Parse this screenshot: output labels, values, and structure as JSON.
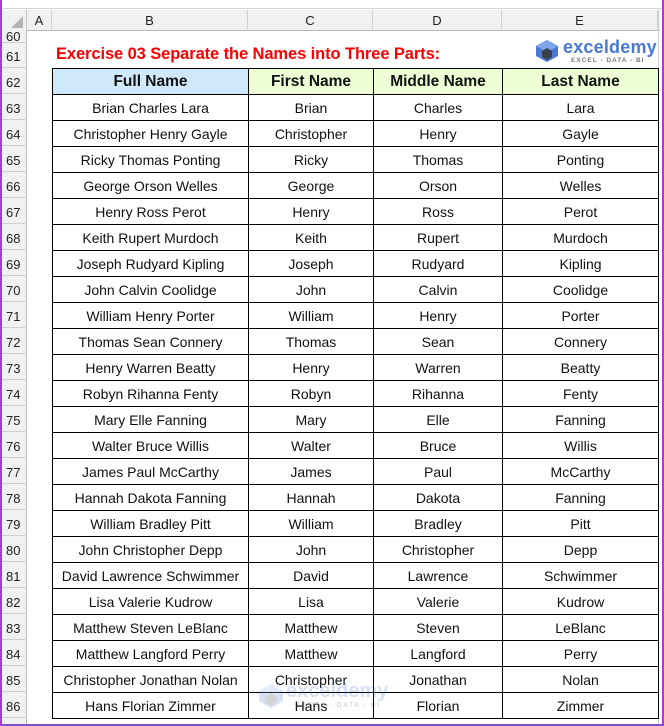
{
  "sheet": {
    "column_headers": [
      "A",
      "B",
      "C",
      "D",
      "E"
    ],
    "row_numbers": [
      "60",
      "61",
      "62",
      "63",
      "64",
      "65",
      "66",
      "67",
      "68",
      "69",
      "70",
      "71",
      "72",
      "73",
      "74",
      "75",
      "76",
      "77",
      "78",
      "79",
      "80",
      "81",
      "82",
      "83",
      "84",
      "85",
      "86"
    ]
  },
  "title": "Exercise 03 Separate the Names into Three Parts:",
  "logo": {
    "name": "exceldemy",
    "tagline": "EXCEL - DATA - BI",
    "icon": "exceldemy-logo-icon"
  },
  "colors": {
    "title": "#ff0000",
    "full_name_header_bg": "#cfe9fb",
    "part_header_bg": "#eeffd6",
    "brand_blue": "#4a79d4",
    "frame": "#a83ad6"
  },
  "table": {
    "headers": [
      "Full Name",
      "First Name",
      "Middle Name",
      "Last Name"
    ],
    "rows": [
      [
        "Brian Charles Lara",
        "Brian",
        "Charles",
        "Lara"
      ],
      [
        "Christopher Henry Gayle",
        "Christopher",
        "Henry",
        "Gayle"
      ],
      [
        "Ricky Thomas Ponting",
        "Ricky",
        "Thomas",
        "Ponting"
      ],
      [
        "George Orson Welles",
        "George",
        "Orson",
        "Welles"
      ],
      [
        "Henry Ross Perot",
        "Henry",
        "Ross",
        "Perot"
      ],
      [
        "Keith Rupert Murdoch",
        "Keith",
        "Rupert",
        "Murdoch"
      ],
      [
        "Joseph Rudyard Kipling",
        "Joseph",
        "Rudyard",
        "Kipling"
      ],
      [
        "John Calvin Coolidge",
        "John",
        "Calvin",
        "Coolidge"
      ],
      [
        "William Henry Porter",
        "William",
        "Henry",
        "Porter"
      ],
      [
        "Thomas Sean Connery",
        "Thomas",
        "Sean",
        "Connery"
      ],
      [
        "Henry Warren Beatty",
        "Henry",
        "Warren",
        "Beatty"
      ],
      [
        "Robyn Rihanna Fenty",
        "Robyn",
        "Rihanna",
        "Fenty"
      ],
      [
        "Mary Elle Fanning",
        "Mary",
        "Elle",
        "Fanning"
      ],
      [
        "Walter Bruce Willis",
        "Walter",
        "Bruce",
        "Willis"
      ],
      [
        "James Paul McCarthy",
        "James",
        "Paul",
        "McCarthy"
      ],
      [
        "Hannah Dakota Fanning",
        "Hannah",
        "Dakota",
        "Fanning"
      ],
      [
        "William Bradley Pitt",
        "William",
        "Bradley",
        "Pitt"
      ],
      [
        "John Christopher Depp",
        "John",
        "Christopher",
        "Depp"
      ],
      [
        "David Lawrence Schwimmer",
        "David",
        "Lawrence",
        "Schwimmer"
      ],
      [
        "Lisa Valerie Kudrow",
        "Lisa",
        "Valerie",
        "Kudrow"
      ],
      [
        "Matthew Steven LeBlanc",
        "Matthew",
        "Steven",
        "LeBlanc"
      ],
      [
        "Matthew Langford Perry",
        "Matthew",
        "Langford",
        "Perry"
      ],
      [
        "Christopher Jonathan Nolan",
        "Christopher",
        "Jonathan",
        "Nolan"
      ],
      [
        "Hans Florian Zimmer",
        "Hans",
        "Florian",
        "Zimmer"
      ]
    ]
  },
  "watermark": {
    "name": "exceldemy",
    "tagline": "EXCEL - DATA - BI"
  }
}
